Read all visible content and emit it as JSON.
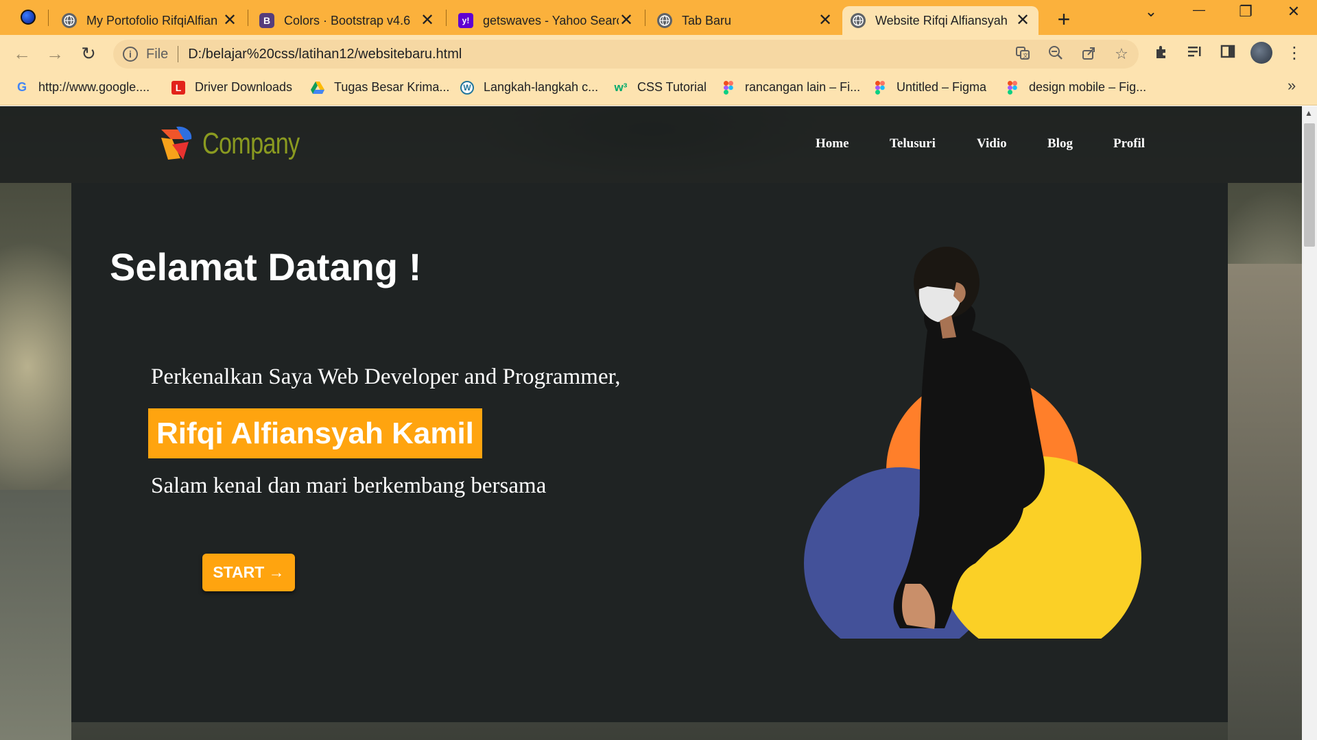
{
  "browser": {
    "tabs": [
      {
        "title": "",
        "icon": "browser-logo-icon"
      },
      {
        "title": "My Portofolio RifqiAlfian",
        "icon": "globe-icon"
      },
      {
        "title": "Colors · Bootstrap v4.6",
        "icon": "bootstrap-icon",
        "glyph": "B"
      },
      {
        "title": "getswaves - Yahoo Search",
        "icon": "yahoo-icon",
        "glyph": "y!"
      },
      {
        "title": "Tab Baru",
        "icon": "globe-icon"
      },
      {
        "title": "Website Rifqi Alfiansyah",
        "icon": "globe-icon",
        "active": true
      }
    ],
    "close_glyph": "✕",
    "new_tab_glyph": "+",
    "window_controls": {
      "tab_search": "⌄",
      "minimize": "—",
      "restore": "❐",
      "close": "✕"
    },
    "address": {
      "scheme_label": "File",
      "url": "D:/belajar%20css/latihan12/websitebaru.html"
    },
    "bookmarks": [
      {
        "label": "http://www.google....",
        "icon": "google-icon",
        "glyph": "G",
        "color": "#4285f4"
      },
      {
        "label": "Driver Downloads",
        "icon": "lenovo-icon",
        "glyph": "L",
        "color": "#e2231a"
      },
      {
        "label": "Tugas Besar Krima...",
        "icon": "google-drive-icon",
        "glyph": "▲",
        "color": "#1fa463"
      },
      {
        "label": "Langkah-langkah c...",
        "icon": "wordpress-icon",
        "glyph": "W",
        "color": "#21759b"
      },
      {
        "label": "CSS Tutorial",
        "icon": "w3schools-icon",
        "glyph": "w³",
        "color": "#04aa6d"
      },
      {
        "label": "rancangan lain – Fi...",
        "icon": "figma-icon",
        "glyph": "",
        "color": "#f24e1e"
      },
      {
        "label": "Untitled – Figma",
        "icon": "figma-icon",
        "glyph": "",
        "color": "#f24e1e"
      },
      {
        "label": "design mobile – Fig...",
        "icon": "figma-icon",
        "glyph": "",
        "color": "#f24e1e"
      }
    ],
    "bookmarks_overflow": "»"
  },
  "site": {
    "logo_text": "Company",
    "nav": [
      "Home",
      "Telusuri",
      "Vidio",
      "Blog",
      "Profil"
    ],
    "hero": {
      "title": "Selamat Datang !",
      "intro": "Perkenalkan Saya Web Developer and Programmer,",
      "name": "Rifqi Alfiansyah Kamil",
      "greeting": "Salam kenal dan mari berkembang bersama",
      "button": "START →"
    }
  },
  "colors": {
    "tab_strip": "#fbb13c",
    "toolbar": "#fde3b0",
    "hero_bg": "#1f2323",
    "accent_orange": "#ffa40f",
    "circle_orange": "#ff7f2a",
    "circle_blue": "#435199",
    "circle_yellow": "#fbd026",
    "logo_text": "#8a9a20"
  }
}
